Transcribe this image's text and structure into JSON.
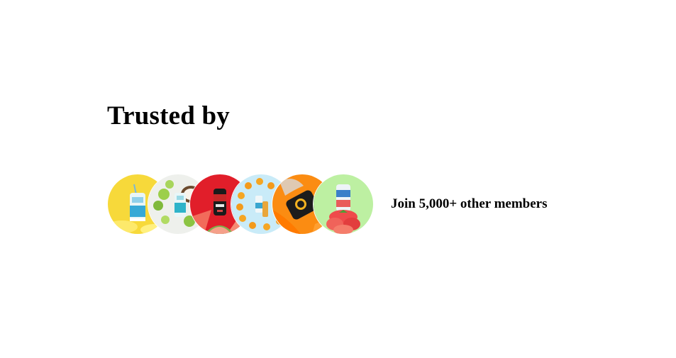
{
  "section": {
    "title": "Trusted by",
    "members_text": "Join 5,000+ other members"
  },
  "avatars": [
    {
      "name": "lemon-can-image",
      "bg": "#f7d93a"
    },
    {
      "name": "coconut-lime-can-image",
      "bg": "#eef0ec"
    },
    {
      "name": "watermelon-can-image",
      "bg": "#e11e2a"
    },
    {
      "name": "orange-slices-can-image",
      "bg": "#c9ebf8"
    },
    {
      "name": "orange-splash-can-image",
      "bg": "#fb8c12"
    },
    {
      "name": "strawberry-can-image",
      "bg": "#bdf0a2"
    }
  ]
}
